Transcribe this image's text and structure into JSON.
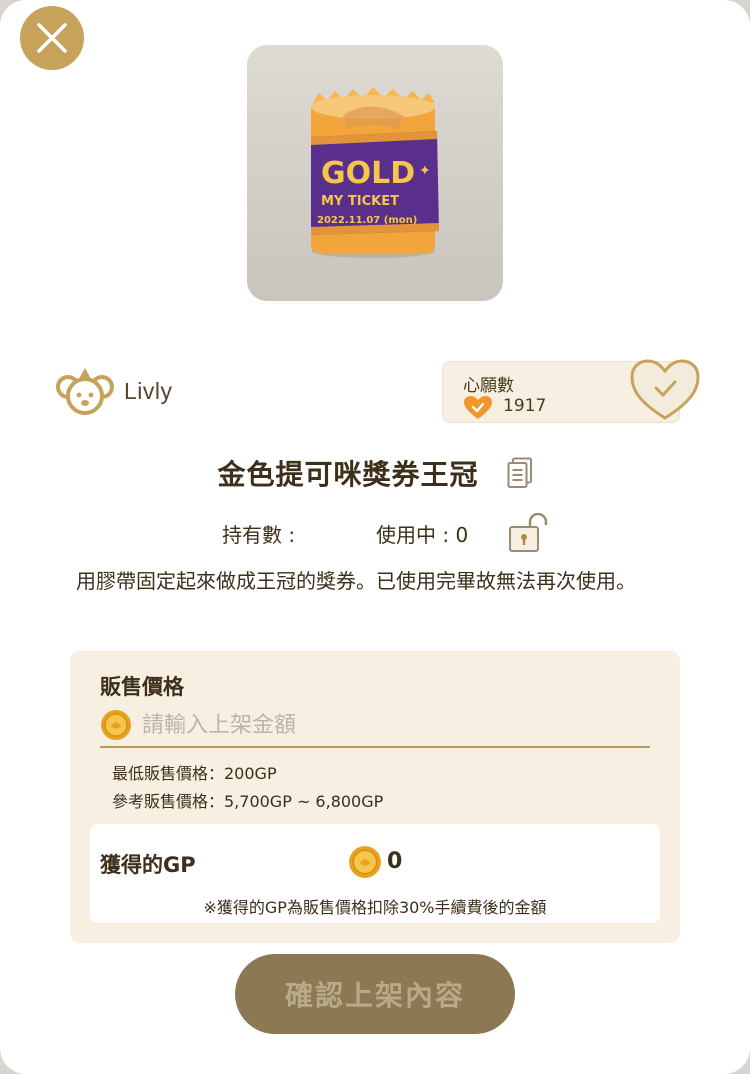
{
  "colors": {
    "accent": "#c6a25a",
    "panel": "#f6efe2",
    "text": "#3d2f1a",
    "button_disabled": "#8d7854"
  },
  "header": {
    "close_icon": "close-icon"
  },
  "item": {
    "image_text": {
      "line1": "GOLD",
      "line2": "MY TICKET",
      "line3": "2022.11.07 (mon)"
    },
    "brand": "Livly",
    "title": "金色提可咪獎券王冠",
    "holdings_label": "持有數 :",
    "in_use_label": "使用中 : 0",
    "description": "用膠帶固定起來做成王冠的獎券。已使用完畢故無法再次使用。"
  },
  "wishlist": {
    "label": "心願數",
    "count": "1917"
  },
  "sell": {
    "label": "販售價格",
    "placeholder": "請輸入上架金額",
    "min_price": "最低販售價格：200GP",
    "ref_price": "參考販售價格：5,700GP ~ 6,800GP",
    "gp_label": "獲得的GP",
    "gp_value": "0",
    "gp_note": "※獲得的GP為販售價格扣除30%手續費後的金額"
  },
  "confirm_label": "確認上架內容"
}
